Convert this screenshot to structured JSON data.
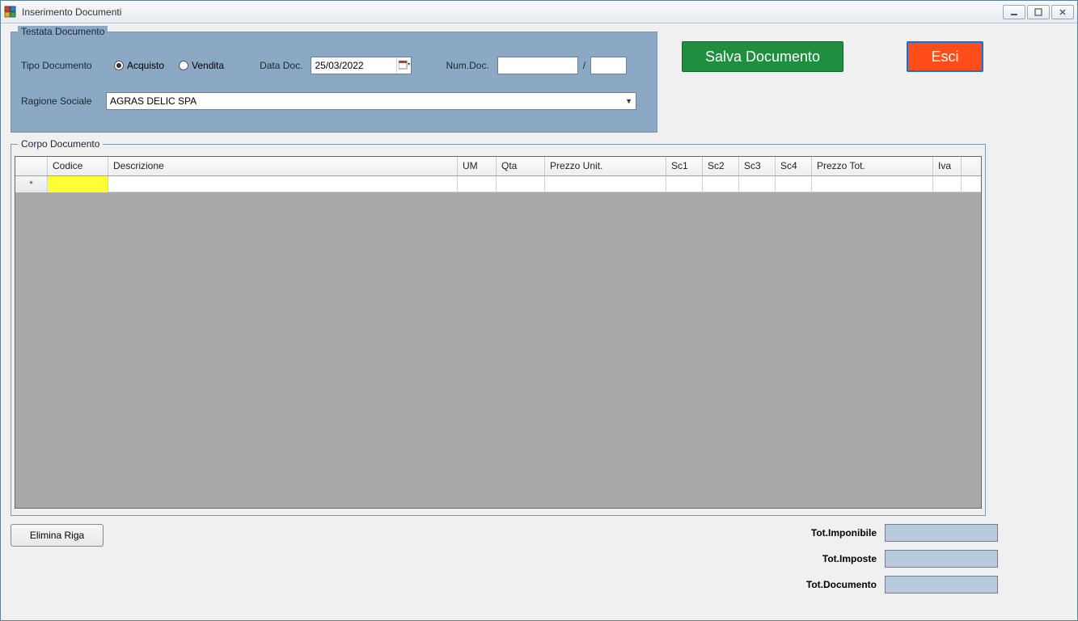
{
  "window": {
    "title": "Inserimento Documenti"
  },
  "buttons": {
    "save": "Salva Documento",
    "exit": "Esci",
    "delete_row": "Elimina Riga"
  },
  "testata": {
    "legend": "Testata Documento",
    "tipo_label": "Tipo Documento",
    "acquisto_label": "Acquisto",
    "vendita_label": "Vendita",
    "tipo_selected": "Acquisto",
    "data_label": "Data Doc.",
    "data_value": "25/03/2022",
    "num_label": "Num.Doc.",
    "num_value": "",
    "num_suffix": "",
    "num_separator": "/",
    "ragione_label": "Ragione Sociale",
    "ragione_value": "AGRAS DELIC SPA"
  },
  "corpo": {
    "legend": "Corpo Documento",
    "columns": {
      "codice": "Codice",
      "descrizione": "Descrizione",
      "um": "UM",
      "qta": "Qta",
      "prezzo_unit": "Prezzo Unit.",
      "sc1": "Sc1",
      "sc2": "Sc2",
      "sc3": "Sc3",
      "sc4": "Sc4",
      "prezzo_tot": "Prezzo Tot.",
      "iva": "Iva"
    },
    "new_row_indicator": "*"
  },
  "totals": {
    "imponibile_label": "Tot.Imponibile",
    "imponibile_value": "",
    "imposte_label": "Tot.Imposte",
    "imposte_value": "",
    "documento_label": "Tot.Documento",
    "documento_value": ""
  }
}
